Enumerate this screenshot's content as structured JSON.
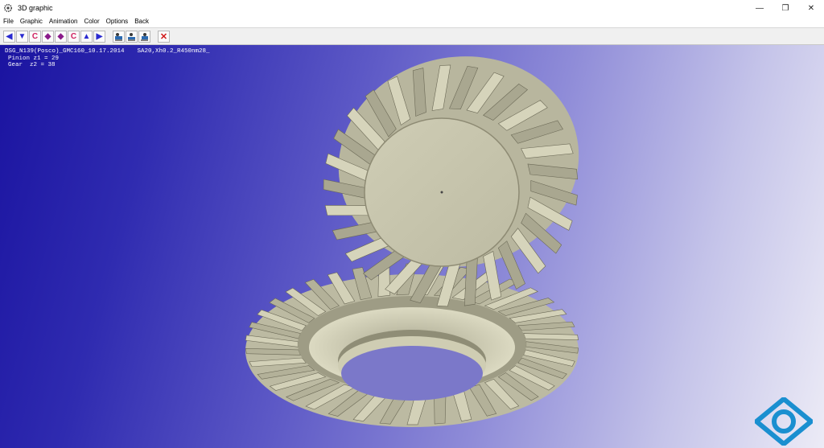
{
  "window": {
    "title": "3D graphic",
    "icon": "gear-app-icon",
    "minimize": "—",
    "restore": "❐",
    "close": "✕"
  },
  "menu": [
    "File",
    "Graphic",
    "Animation",
    "Color",
    "Options",
    "Back"
  ],
  "toolbar": {
    "buttons": [
      {
        "name": "rotate-left-button",
        "glyph": "◀",
        "color": "#2a2ad0"
      },
      {
        "name": "rotate-down-button",
        "glyph": "▼",
        "color": "#2a2ad0"
      },
      {
        "name": "rotate-ccw-button",
        "glyph": "C",
        "color": "#d02060"
      },
      {
        "name": "diamond-1-button",
        "glyph": "◆",
        "color": "#8a1a8a"
      },
      {
        "name": "diamond-2-button",
        "glyph": "◆",
        "color": "#8a1a8a"
      },
      {
        "name": "rotate-cw-button",
        "glyph": "C",
        "color": "#d02060"
      },
      {
        "name": "rotate-up-button",
        "glyph": "▲",
        "color": "#2a2ad0"
      },
      {
        "name": "rotate-right-button",
        "glyph": "▶",
        "color": "#2a2ad0"
      }
    ],
    "view_buttons": [
      "view-1-icon",
      "view-2-icon",
      "view-3-icon"
    ],
    "close_glyph": "✕"
  },
  "info": {
    "line1a": "DSG_N139(Posco)_GMC160_10.17.2014",
    "line1b": "SA20,Xh0.2_R450nm28_",
    "pinion": "Pinion z1 = 29",
    "gear": "Gear  z2 = 38"
  },
  "colors": {
    "gear_face": "#c9c7ad",
    "gear_dark": "#8e8b74",
    "tooth_shadow": "#6b6956",
    "logo": "#1a8fd0"
  }
}
